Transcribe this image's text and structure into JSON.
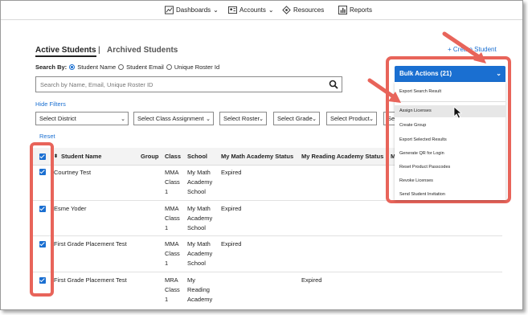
{
  "nav": {
    "dashboards": "Dashboards",
    "accounts": "Accounts",
    "resources": "Resources",
    "reports": "Reports"
  },
  "tabs": {
    "active": "Active Students",
    "separator": "|",
    "archived": "Archived Students"
  },
  "create_student": "+ Create Student",
  "search_by": {
    "label": "Search By:",
    "options": [
      "Student Name",
      "Student Email",
      "Unique Roster Id"
    ],
    "selected": "Student Name"
  },
  "search": {
    "placeholder": "Search by Name, Email, Unique Roster ID"
  },
  "hide_filters": "Hide Filters",
  "filters": {
    "district": "Select District",
    "class_assignment": "Select Class Assignment",
    "roster": "Select Roster",
    "grade": "Select Grade",
    "product": "Select Product",
    "status": "Select Status"
  },
  "reset": "Reset",
  "table": {
    "headers": {
      "student_name": "Student Name",
      "group": "Group",
      "class": "Class",
      "school": "School",
      "math_status": "My Math Academy Status",
      "reading_status": "My Reading Academy Status",
      "more": "M"
    },
    "rows": [
      {
        "name": "Courtney Test",
        "group": "",
        "class": [
          "MMA",
          "Class",
          "1"
        ],
        "school": [
          "My Math",
          "Academy",
          "School"
        ],
        "math_status": "Expired",
        "reading_status": ""
      },
      {
        "name": "Esme Yoder",
        "group": "",
        "class": [
          "MMA",
          "Class",
          "1"
        ],
        "school": [
          "My Math",
          "Academy",
          "School"
        ],
        "math_status": "Expired",
        "reading_status": ""
      },
      {
        "name": "First Grade Placement Test",
        "group": "",
        "class": [
          "MMA",
          "Class",
          "1"
        ],
        "school": [
          "My Math",
          "Academy",
          "School"
        ],
        "math_status": "Expired",
        "reading_status": ""
      },
      {
        "name": "First Grade Placement Test",
        "group": "",
        "class": [
          "MRA",
          "Class",
          "1"
        ],
        "school": [
          "My",
          "Reading",
          "Academy"
        ],
        "math_status": "",
        "reading_status": "Expired"
      }
    ]
  },
  "bulk": {
    "title": "Bulk Actions (21)",
    "items": [
      "Export Search Result",
      "Assign Licenses",
      "Create Group",
      "Export Selected Results",
      "Generate QR for Login",
      "Reset Product Passcodes",
      "Revoke Licenses",
      "Send Student Invitation"
    ],
    "highlighted": "Assign Licenses"
  },
  "colors": {
    "accent": "#1a6fd1",
    "annotation": "#e8645a"
  }
}
